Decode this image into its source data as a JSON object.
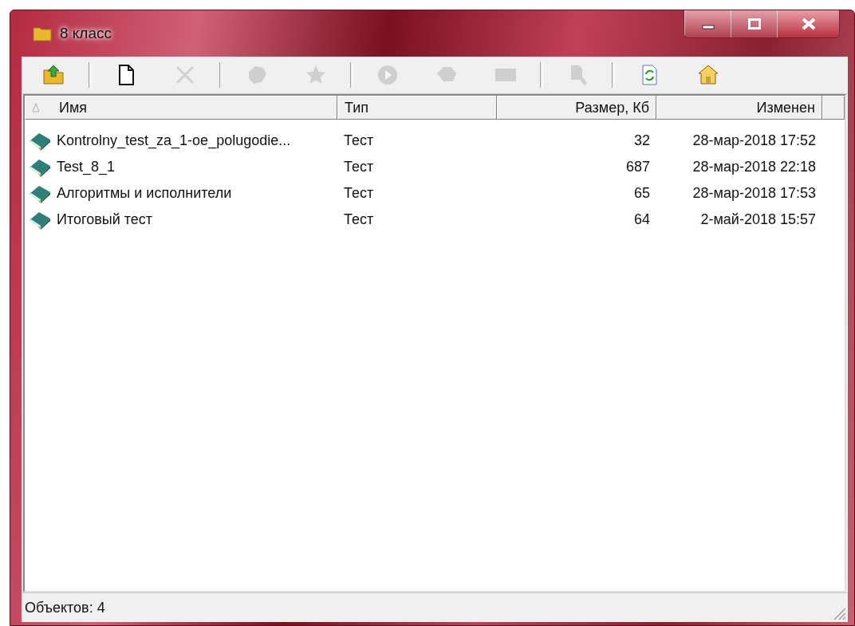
{
  "window": {
    "title": "8 класс"
  },
  "toolbar": [
    {
      "kind": "up",
      "disabled": false
    },
    {
      "kind": "separator"
    },
    {
      "kind": "new",
      "disabled": false
    },
    {
      "kind": "delete",
      "disabled": true
    },
    {
      "kind": "separator"
    },
    {
      "kind": "blob",
      "disabled": true
    },
    {
      "kind": "star",
      "disabled": true
    },
    {
      "kind": "separator"
    },
    {
      "kind": "play",
      "disabled": true
    },
    {
      "kind": "tag",
      "disabled": true
    },
    {
      "kind": "rect",
      "disabled": true
    },
    {
      "kind": "separator"
    },
    {
      "kind": "find",
      "disabled": true
    },
    {
      "kind": "separator"
    },
    {
      "kind": "refresh",
      "disabled": false
    },
    {
      "kind": "home",
      "disabled": false
    }
  ],
  "columns": [
    {
      "label": "Имя",
      "sorted": true
    },
    {
      "label": "Тип",
      "sorted": false
    },
    {
      "label": "Размер, Кб",
      "sorted": false
    },
    {
      "label": "Изменен",
      "sorted": false
    }
  ],
  "rows": [
    {
      "name": "Kontrolny_test_za_1-oe_polugodie...",
      "type": "Тест",
      "size": "32",
      "modified": "28-мар-2018 17:52"
    },
    {
      "name": "Test_8_1",
      "type": "Тест",
      "size": "687",
      "modified": "28-мар-2018 22:18"
    },
    {
      "name": "Алгоритмы и исполнители",
      "type": "Тест",
      "size": "65",
      "modified": "28-мар-2018 17:53"
    },
    {
      "name": "Итоговый тест",
      "type": "Тест",
      "size": "64",
      "modified": "2-май-2018 15:57"
    }
  ],
  "status_bar": {
    "text": "Объектов: 4"
  }
}
